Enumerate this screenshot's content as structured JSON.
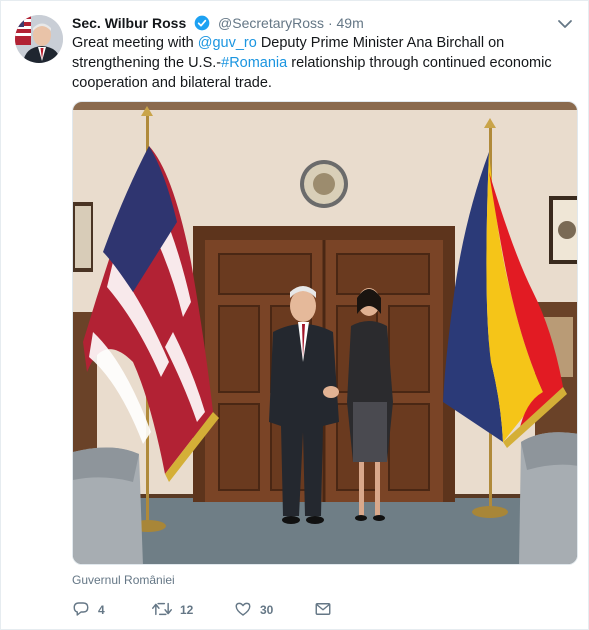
{
  "tweet": {
    "display_name": "Sec. Wilbur Ross",
    "handle": "@SecretaryRoss",
    "separator": "·",
    "time": "49m",
    "text_parts": {
      "t1": "Great meeting with ",
      "mention": "@guv_ro",
      "t2": " Deputy Prime Minister Ana Birchall on strengthening the U.S.-",
      "hashtag": "#Romania",
      "t3": " relationship through continued economic cooperation and bilateral trade."
    },
    "media_attribution": "Guvernul României",
    "actions": {
      "replies": "4",
      "retweets": "12",
      "likes": "30"
    }
  },
  "icons": {
    "verified": "verified-badge-icon",
    "caret": "chevron-down-icon",
    "reply": "reply-icon",
    "retweet": "retweet-icon",
    "like": "heart-icon",
    "dm": "envelope-icon"
  },
  "colors": {
    "link": "#1b95e0",
    "secondary_text": "#657786",
    "border": "#e6ecf0"
  }
}
